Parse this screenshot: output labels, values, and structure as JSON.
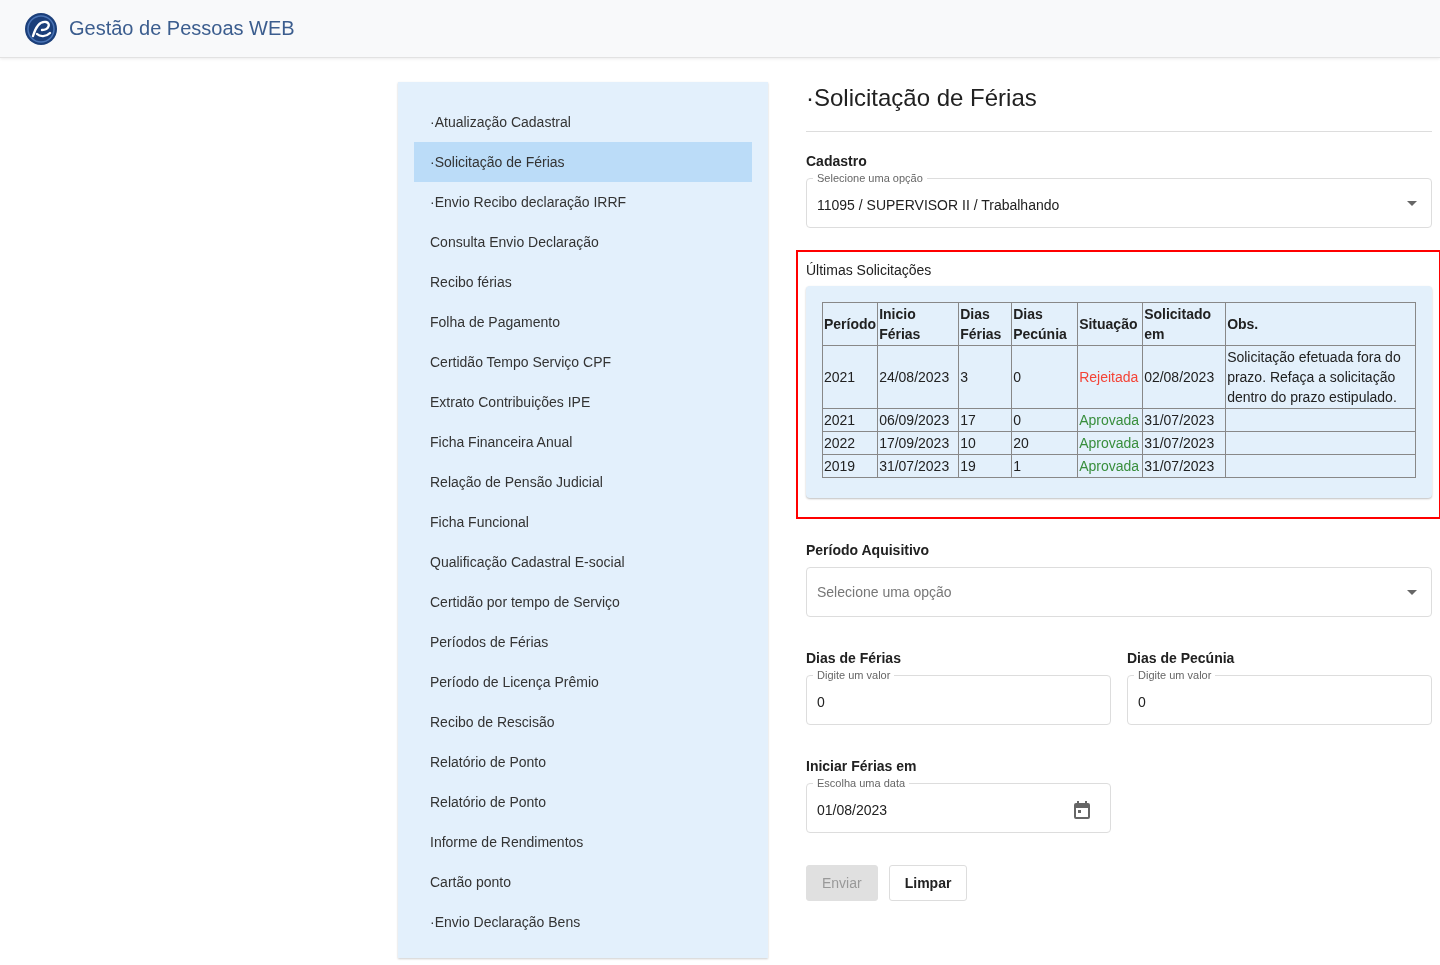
{
  "app": {
    "title": "Gestão de Pessoas WEB"
  },
  "sidebar": {
    "items": [
      {
        "label": "·Atualização Cadastral",
        "selected": false
      },
      {
        "label": "·Solicitação de Férias",
        "selected": true
      },
      {
        "label": "·Envio Recibo declaração IRRF",
        "selected": false
      },
      {
        "label": "Consulta Envio Declaração",
        "selected": false
      },
      {
        "label": "Recibo férias",
        "selected": false
      },
      {
        "label": "Folha de Pagamento",
        "selected": false
      },
      {
        "label": "Certidão Tempo Serviço CPF",
        "selected": false
      },
      {
        "label": "Extrato Contribuições IPE",
        "selected": false
      },
      {
        "label": "Ficha Financeira Anual",
        "selected": false
      },
      {
        "label": "Relação de Pensão Judicial",
        "selected": false
      },
      {
        "label": "Ficha Funcional",
        "selected": false
      },
      {
        "label": "Qualificação Cadastral E-social",
        "selected": false
      },
      {
        "label": "Certidão por tempo de Serviço",
        "selected": false
      },
      {
        "label": "Períodos de Férias",
        "selected": false
      },
      {
        "label": "Período de Licença Prêmio",
        "selected": false
      },
      {
        "label": "Recibo de Rescisão",
        "selected": false
      },
      {
        "label": "Relatório de Ponto",
        "selected": false
      },
      {
        "label": "Relatório de Ponto",
        "selected": false
      },
      {
        "label": "Informe de Rendimentos",
        "selected": false
      },
      {
        "label": "Cartão ponto",
        "selected": false
      },
      {
        "label": "·Envio Declaração Bens",
        "selected": false
      }
    ]
  },
  "page": {
    "title": "·Solicitação de Férias"
  },
  "cadastro": {
    "label": "Cadastro",
    "floating_label": "Selecione uma opção",
    "value": "11095 / SUPERVISOR II / Trabalhando"
  },
  "requests": {
    "title": "Últimas Solicitações",
    "highlighted": true,
    "columns": [
      [
        "Período"
      ],
      [
        "Inicio",
        "Férias"
      ],
      [
        "Dias",
        "Férias"
      ],
      [
        "Dias",
        "Pecúnia"
      ],
      [
        "Situação"
      ],
      [
        "Solicitado",
        "em"
      ],
      [
        "Obs."
      ]
    ],
    "rows": [
      {
        "periodo": "2021",
        "inicio": "24/08/2023",
        "dias_ferias": "3",
        "dias_pecunia": "0",
        "situacao": "Rejeitada",
        "color": "#f44336",
        "solicitado": "02/08/2023",
        "obs": "Solicitação efetuada fora do prazo. Refaça a solicitação dentro do prazo estipulado."
      },
      {
        "periodo": "2021",
        "inicio": "06/09/2023",
        "dias_ferias": "17",
        "dias_pecunia": "0",
        "situacao": "Aprovada",
        "color": "#388e3c",
        "solicitado": "31/07/2023",
        "obs": ""
      },
      {
        "periodo": "2022",
        "inicio": "17/09/2023",
        "dias_ferias": "10",
        "dias_pecunia": "20",
        "situacao": "Aprovada",
        "color": "#388e3c",
        "solicitado": "31/07/2023",
        "obs": ""
      },
      {
        "periodo": "2019",
        "inicio": "31/07/2023",
        "dias_ferias": "19",
        "dias_pecunia": "1",
        "situacao": "Aprovada",
        "color": "#388e3c",
        "solicitado": "31/07/2023",
        "obs": ""
      }
    ]
  },
  "periodo_aquisitivo": {
    "label": "Período Aquisitivo",
    "placeholder": "Selecione uma opção"
  },
  "dias_ferias": {
    "label": "Dias de Férias",
    "floating_label": "Digite um valor",
    "value": "0"
  },
  "dias_pecunia": {
    "label": "Dias de Pecúnia",
    "floating_label": "Digite um valor",
    "value": "0"
  },
  "inicio": {
    "label": "Iniciar Férias em",
    "floating_label": "Escolha uma data",
    "value": "01/08/2023"
  },
  "buttons": [
    {
      "label": "Enviar",
      "disabled": true
    },
    {
      "label": "Limpar",
      "disabled": false
    }
  ]
}
